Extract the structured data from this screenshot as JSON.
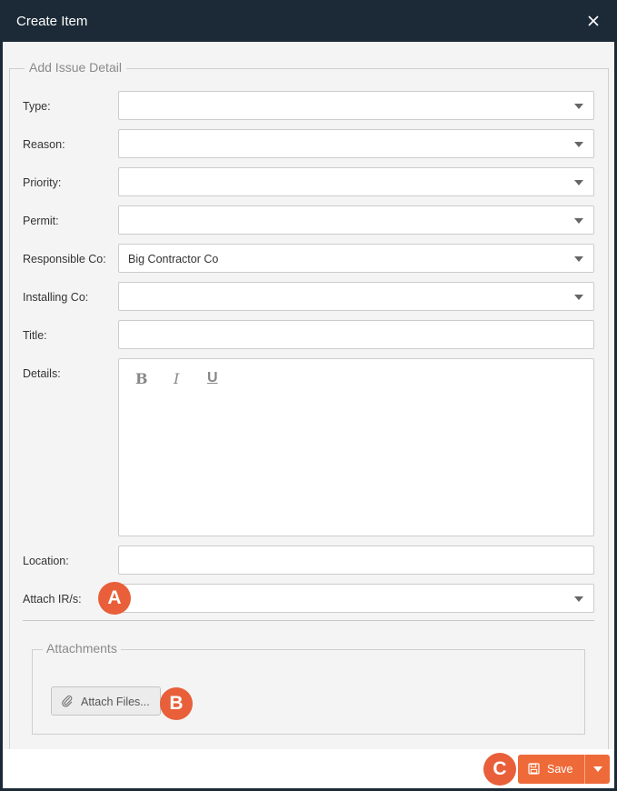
{
  "dialog": {
    "title": "Create Item",
    "close_icon": "close-icon"
  },
  "form": {
    "legend": "Add Issue Detail",
    "fields": {
      "type": {
        "label": "Type:",
        "value": ""
      },
      "reason": {
        "label": "Reason:",
        "value": ""
      },
      "priority": {
        "label": "Priority:",
        "value": ""
      },
      "permit": {
        "label": "Permit:",
        "value": ""
      },
      "responsible_co": {
        "label": "Responsible Co:",
        "value": "Big Contractor Co"
      },
      "installing_co": {
        "label": "Installing Co:",
        "value": ""
      },
      "title": {
        "label": "Title:",
        "value": ""
      },
      "details": {
        "label": "Details:",
        "value": "",
        "toolbar": {
          "bold": "B",
          "italic": "I",
          "underline": "U"
        }
      },
      "location": {
        "label": "Location:",
        "value": ""
      },
      "attach_irs": {
        "label": "Attach IR/s:",
        "value": ""
      }
    }
  },
  "attachments": {
    "legend": "Attachments",
    "attach_button": "Attach Files...",
    "icon": "paperclip-icon"
  },
  "footer": {
    "save_label": "Save",
    "save_icon": "floppy-disk-icon"
  },
  "annotations": {
    "a": "A",
    "b": "B",
    "c": "C",
    "color": "#e85f3a"
  },
  "colors": {
    "titlebar": "#1b2a36",
    "accent": "#ee6a39",
    "panel_bg": "#f4f4f4"
  }
}
